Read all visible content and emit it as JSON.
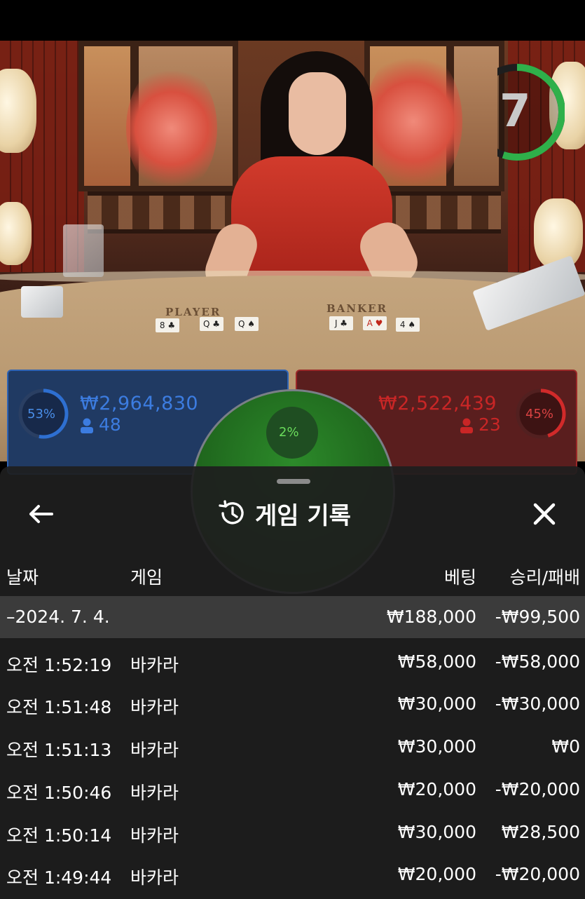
{
  "timer": {
    "value": "7",
    "progress": 0.55
  },
  "table_labels": {
    "player": "PLAYER",
    "banker": "BANKER"
  },
  "player_cards": [
    "8 ♣",
    "Q ♣",
    "Q ♠"
  ],
  "banker_cards": [
    "J ♣",
    "A ♥",
    "4 ♠"
  ],
  "bets": {
    "player": {
      "percent": "53%",
      "amount": "₩2,964,830",
      "count": "48",
      "color": "#2e6fd1"
    },
    "banker": {
      "percent": "45%",
      "amount": "₩2,522,439",
      "count": "23",
      "color": "#d12a2a"
    },
    "tie": {
      "percent": "2%",
      "color": "#3db33a"
    }
  },
  "history": {
    "title": "게임 기록",
    "back_icon": "arrow-left-icon",
    "history_icon": "history-clock-icon",
    "close_icon": "close-icon",
    "columns": {
      "date": "날짜",
      "game": "게임",
      "bet": "베팅",
      "result": "승리/패배"
    },
    "date_group": {
      "label": "–2024. 7. 4.",
      "bet": "₩188,000",
      "result": "-₩99,500"
    },
    "rows": [
      {
        "time": "오전 1:52:19",
        "game": "바카라",
        "bet": "₩58,000",
        "result": "-₩58,000"
      },
      {
        "time": "오전 1:51:48",
        "game": "바카라",
        "bet": "₩30,000",
        "result": "-₩30,000"
      },
      {
        "time": "오전 1:51:13",
        "game": "바카라",
        "bet": "₩30,000",
        "result": "₩0"
      },
      {
        "time": "오전 1:50:46",
        "game": "바카라",
        "bet": "₩20,000",
        "result": "-₩20,000"
      },
      {
        "time": "오전 1:50:14",
        "game": "바카라",
        "bet": "₩30,000",
        "result": "₩28,500"
      },
      {
        "time": "오전 1:49:44",
        "game": "바카라",
        "bet": "₩20,000",
        "result": "-₩20,000"
      }
    ]
  }
}
